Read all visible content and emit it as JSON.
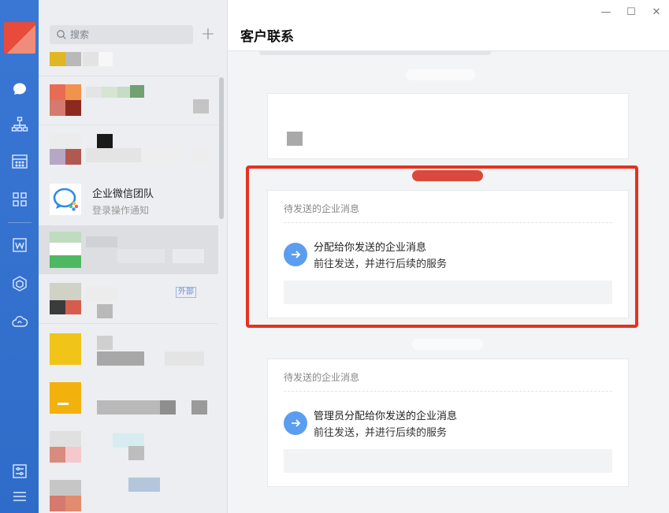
{
  "search": {
    "placeholder": "搜索"
  },
  "chat_list": {
    "featured": {
      "name": "企业微信团队",
      "preview": "登录操作通知"
    },
    "partial_labels": {
      "external_tag": "外部"
    }
  },
  "main": {
    "title": "客户联系",
    "cards": [
      {
        "header": "待发送的企业消息",
        "line1": "分配给你发送的企业消息",
        "line2": "前往发送，并进行后续的服务"
      },
      {
        "header": "待发送的企业消息",
        "line1": "管理员分配给你发送的企业消息",
        "line2": "前往发送，并进行后续的服务"
      }
    ]
  },
  "window_controls": {
    "minimize": "—",
    "maximize": "☐",
    "close": "✕"
  },
  "colors": {
    "rail": "#2f6cc9",
    "accent_arrow": "#5b9ef0",
    "highlight_box": "#e5321f"
  },
  "icons": {
    "rail": [
      "chat-bubble-icon",
      "org-chart-icon",
      "calendar-icon",
      "apps-grid-icon",
      "doc-w-icon",
      "cube-icon",
      "cloud-icon",
      "settings-sliders-icon",
      "menu-icon"
    ]
  }
}
